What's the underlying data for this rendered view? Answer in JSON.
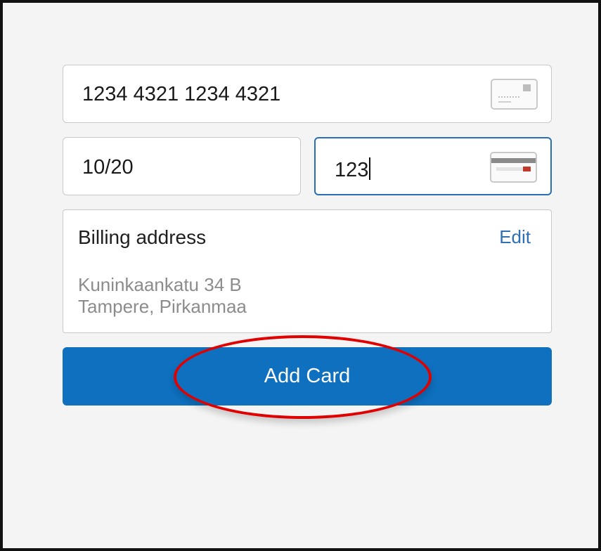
{
  "card_form": {
    "card_number": {
      "value": "1234 4321 1234 4321",
      "icon": "credit-card-icon"
    },
    "expiry": {
      "value": "10/20"
    },
    "cvc": {
      "value": "123",
      "icon": "card-back-cvc-icon"
    },
    "billing": {
      "title": "Billing address",
      "edit_label": "Edit",
      "address_line1": "Kuninkaankatu 34 B",
      "address_line2": "Tampere, Pirkanmaa"
    },
    "submit_label": "Add Card"
  },
  "colors": {
    "primary_button": "#0e70bf",
    "focus_border": "#2a6fb5",
    "link": "#2f6fb5",
    "annotation_ellipse": "#e00000"
  }
}
